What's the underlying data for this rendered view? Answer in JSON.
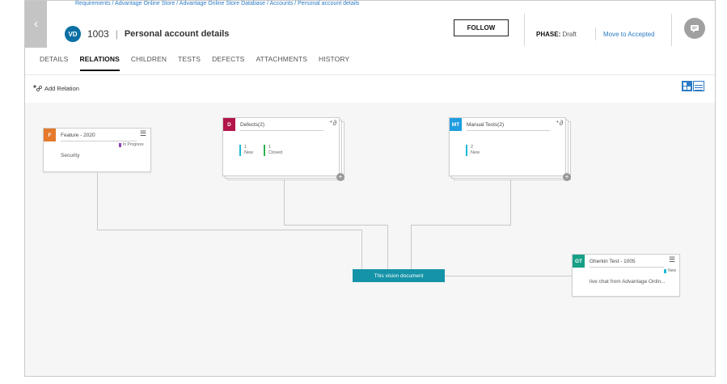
{
  "header": {
    "back_label": "‹",
    "breadcrumb": "Requirements / Advantage Online Store / Advantage Online Store Database / Accounts / Personal account details",
    "avatar_initials": "VD",
    "entity_id": "1003",
    "separator": "|",
    "title": "Personal account details",
    "follow_label": "FOLLOW",
    "phase_label": "PHASE:",
    "phase_value": "Draft",
    "move_label": "Move to Accepted"
  },
  "tabs": [
    {
      "label": "DETAILS"
    },
    {
      "label": "RELATIONS"
    },
    {
      "label": "CHILDREN"
    },
    {
      "label": "TESTS"
    },
    {
      "label": "DEFECTS"
    },
    {
      "label": "ATTACHMENTS"
    },
    {
      "label": "HISTORY"
    }
  ],
  "active_tab": "RELATIONS",
  "toolbar": {
    "add_relation_label": "Add Relation"
  },
  "graph": {
    "feature": {
      "badge": "F",
      "badge_color": "#e5792c",
      "title": "Feature - 2020",
      "status": "In Progress",
      "status_color": "#8e44ad",
      "desc": "Security"
    },
    "defects": {
      "badge": "D",
      "badge_color": "#b2154a",
      "title": "Defects(2)",
      "counts": [
        {
          "n": "1",
          "label": "New",
          "color": "#1db8d8"
        },
        {
          "n": "1",
          "label": "Closed",
          "color": "#2bb24c"
        }
      ]
    },
    "manual_tests": {
      "badge": "MT",
      "badge_color": "#1e9de0",
      "title": "Manual Tests(2)",
      "counts": [
        {
          "n": "2",
          "label": "New",
          "color": "#1db8d8"
        }
      ]
    },
    "center": {
      "label": "This vision document",
      "color": "#1593a8"
    },
    "gherkin": {
      "badge": "GT",
      "badge_color": "#17a086",
      "title": "Gherkin Test - 1005",
      "status": "New",
      "status_color": "#1db8d8",
      "desc": "live chat from Advantage Onlin..."
    }
  }
}
